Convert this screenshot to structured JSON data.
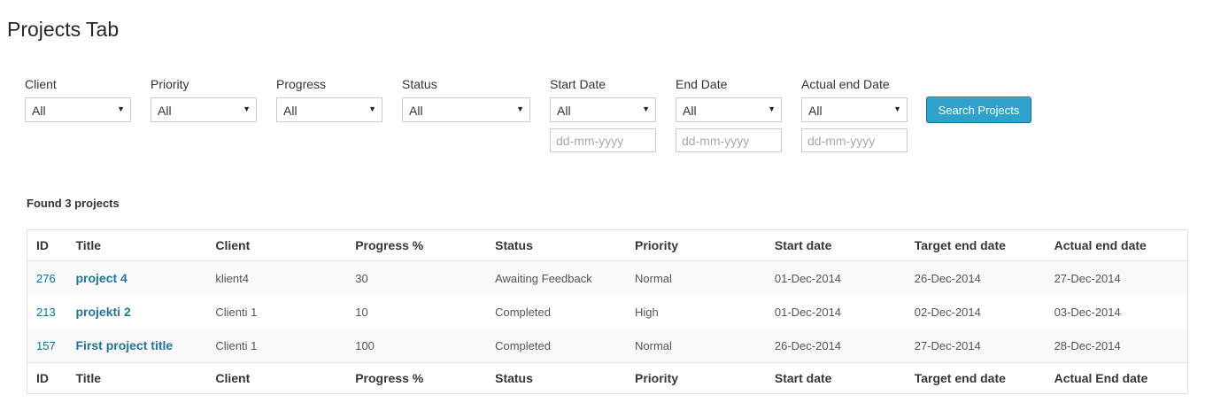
{
  "page_title": "Projects Tab",
  "filters": {
    "client": {
      "label": "Client",
      "value": "All"
    },
    "priority": {
      "label": "Priority",
      "value": "All"
    },
    "progress": {
      "label": "Progress",
      "value": "All"
    },
    "status": {
      "label": "Status",
      "value": "All"
    },
    "start_date": {
      "label": "Start Date",
      "value": "All",
      "placeholder": "dd-mm-yyyy"
    },
    "end_date": {
      "label": "End Date",
      "value": "All",
      "placeholder": "dd-mm-yyyy"
    },
    "actual_end_date": {
      "label": "Actual end Date",
      "value": "All",
      "placeholder": "dd-mm-yyyy"
    }
  },
  "search_button": "Search Projects",
  "found_text": "Found 3 projects",
  "table": {
    "header": [
      "ID",
      "Title",
      "Client",
      "Progress %",
      "Status",
      "Priority",
      "Start date",
      "Target end date",
      "Actual end date"
    ],
    "footer": [
      "ID",
      "Title",
      "Client",
      "Progress %",
      "Status",
      "Priority",
      "Start date",
      "Target end date",
      "Actual End date"
    ],
    "rows": [
      {
        "id": "276",
        "title": "project 4",
        "client": "klient4",
        "progress": "30",
        "status": "Awaiting Feedback",
        "priority": "Normal",
        "start": "01-Dec-2014",
        "target_end": "26-Dec-2014",
        "actual_end": "27-Dec-2014"
      },
      {
        "id": "213",
        "title": "projekti 2",
        "client": "Clienti 1",
        "progress": "10",
        "status": "Completed",
        "priority": "High",
        "start": "01-Dec-2014",
        "target_end": "02-Dec-2014",
        "actual_end": "03-Dec-2014"
      },
      {
        "id": "157",
        "title": "First project title",
        "client": "Clienti 1",
        "progress": "100",
        "status": "Completed",
        "priority": "Normal",
        "start": "26-Dec-2014",
        "target_end": "27-Dec-2014",
        "actual_end": "28-Dec-2014"
      }
    ]
  },
  "colors": {
    "button": "#2ea2cc",
    "link": "#21759b"
  },
  "icons": {
    "dropdown": "caret-down-icon"
  }
}
